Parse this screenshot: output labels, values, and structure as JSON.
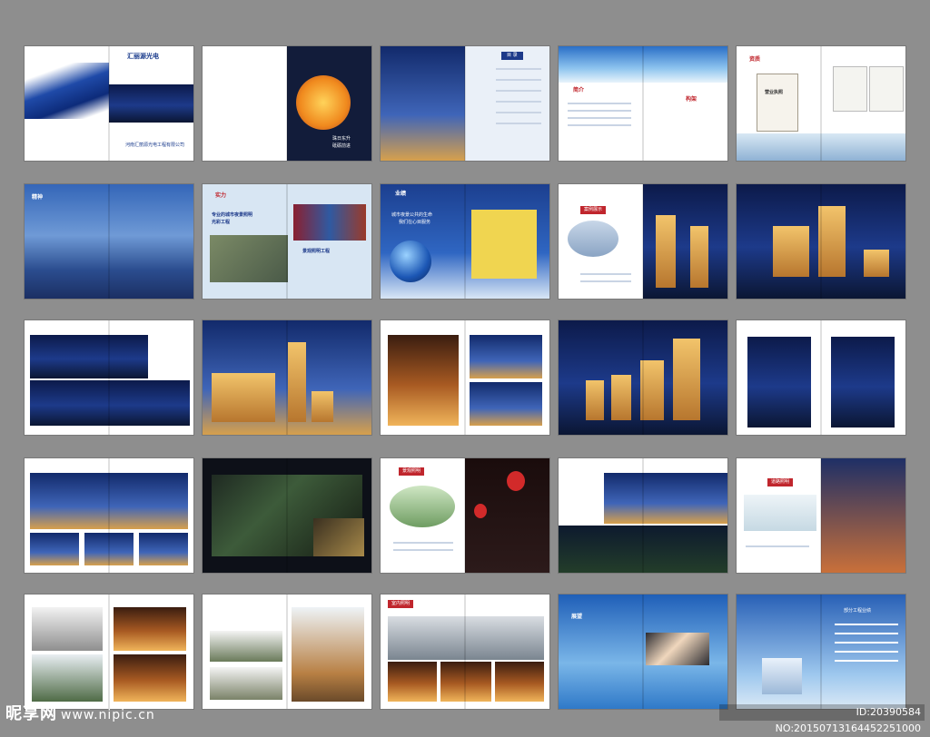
{
  "spreads": [
    {
      "id": "cover",
      "title": "汇丽源光电",
      "company": "河南汇丽源光电工程有限公司"
    },
    {
      "id": "sunset",
      "poem_line1": "珠日东升",
      "poem_line2": "砥砺前进"
    },
    {
      "id": "toc",
      "tab": "目 录"
    },
    {
      "id": "intro",
      "left_title": "简介",
      "right_title": "构架"
    },
    {
      "id": "credentials",
      "title": "资质",
      "certificate": "营业执照"
    },
    {
      "id": "spirit",
      "title": "精神"
    },
    {
      "id": "strength",
      "title": "实力",
      "banner_line1": "专业的城市夜景照明",
      "banner_line2": "光彩工程",
      "banner_line3": "景观照明工程"
    },
    {
      "id": "business",
      "title": "业绩",
      "slogan_line1": "城市夜景公共的生命",
      "slogan_line2": "我们在心目服务"
    },
    {
      "id": "case1",
      "title": "案例展示"
    },
    {
      "id": "case2"
    },
    {
      "id": "case3"
    },
    {
      "id": "case4"
    },
    {
      "id": "case5"
    },
    {
      "id": "case6"
    },
    {
      "id": "case7"
    },
    {
      "id": "case8"
    },
    {
      "id": "case9"
    },
    {
      "id": "case10",
      "title": "景观照明"
    },
    {
      "id": "case11"
    },
    {
      "id": "case12",
      "title": "道路照明"
    },
    {
      "id": "case13"
    },
    {
      "id": "case14"
    },
    {
      "id": "case15",
      "title": "室内照明"
    },
    {
      "id": "outlook",
      "title": "展望"
    },
    {
      "id": "closing",
      "title": "部分工程业绩"
    }
  ],
  "watermark": {
    "brand": "昵享网",
    "url": "www.nipic.cn"
  },
  "image_id": "ID:20390584 NO:20150713164452251000",
  "colors": {
    "background": "#8e8e8e",
    "brand_blue": "#1d3a8a",
    "accent_red": "#c0262d"
  }
}
